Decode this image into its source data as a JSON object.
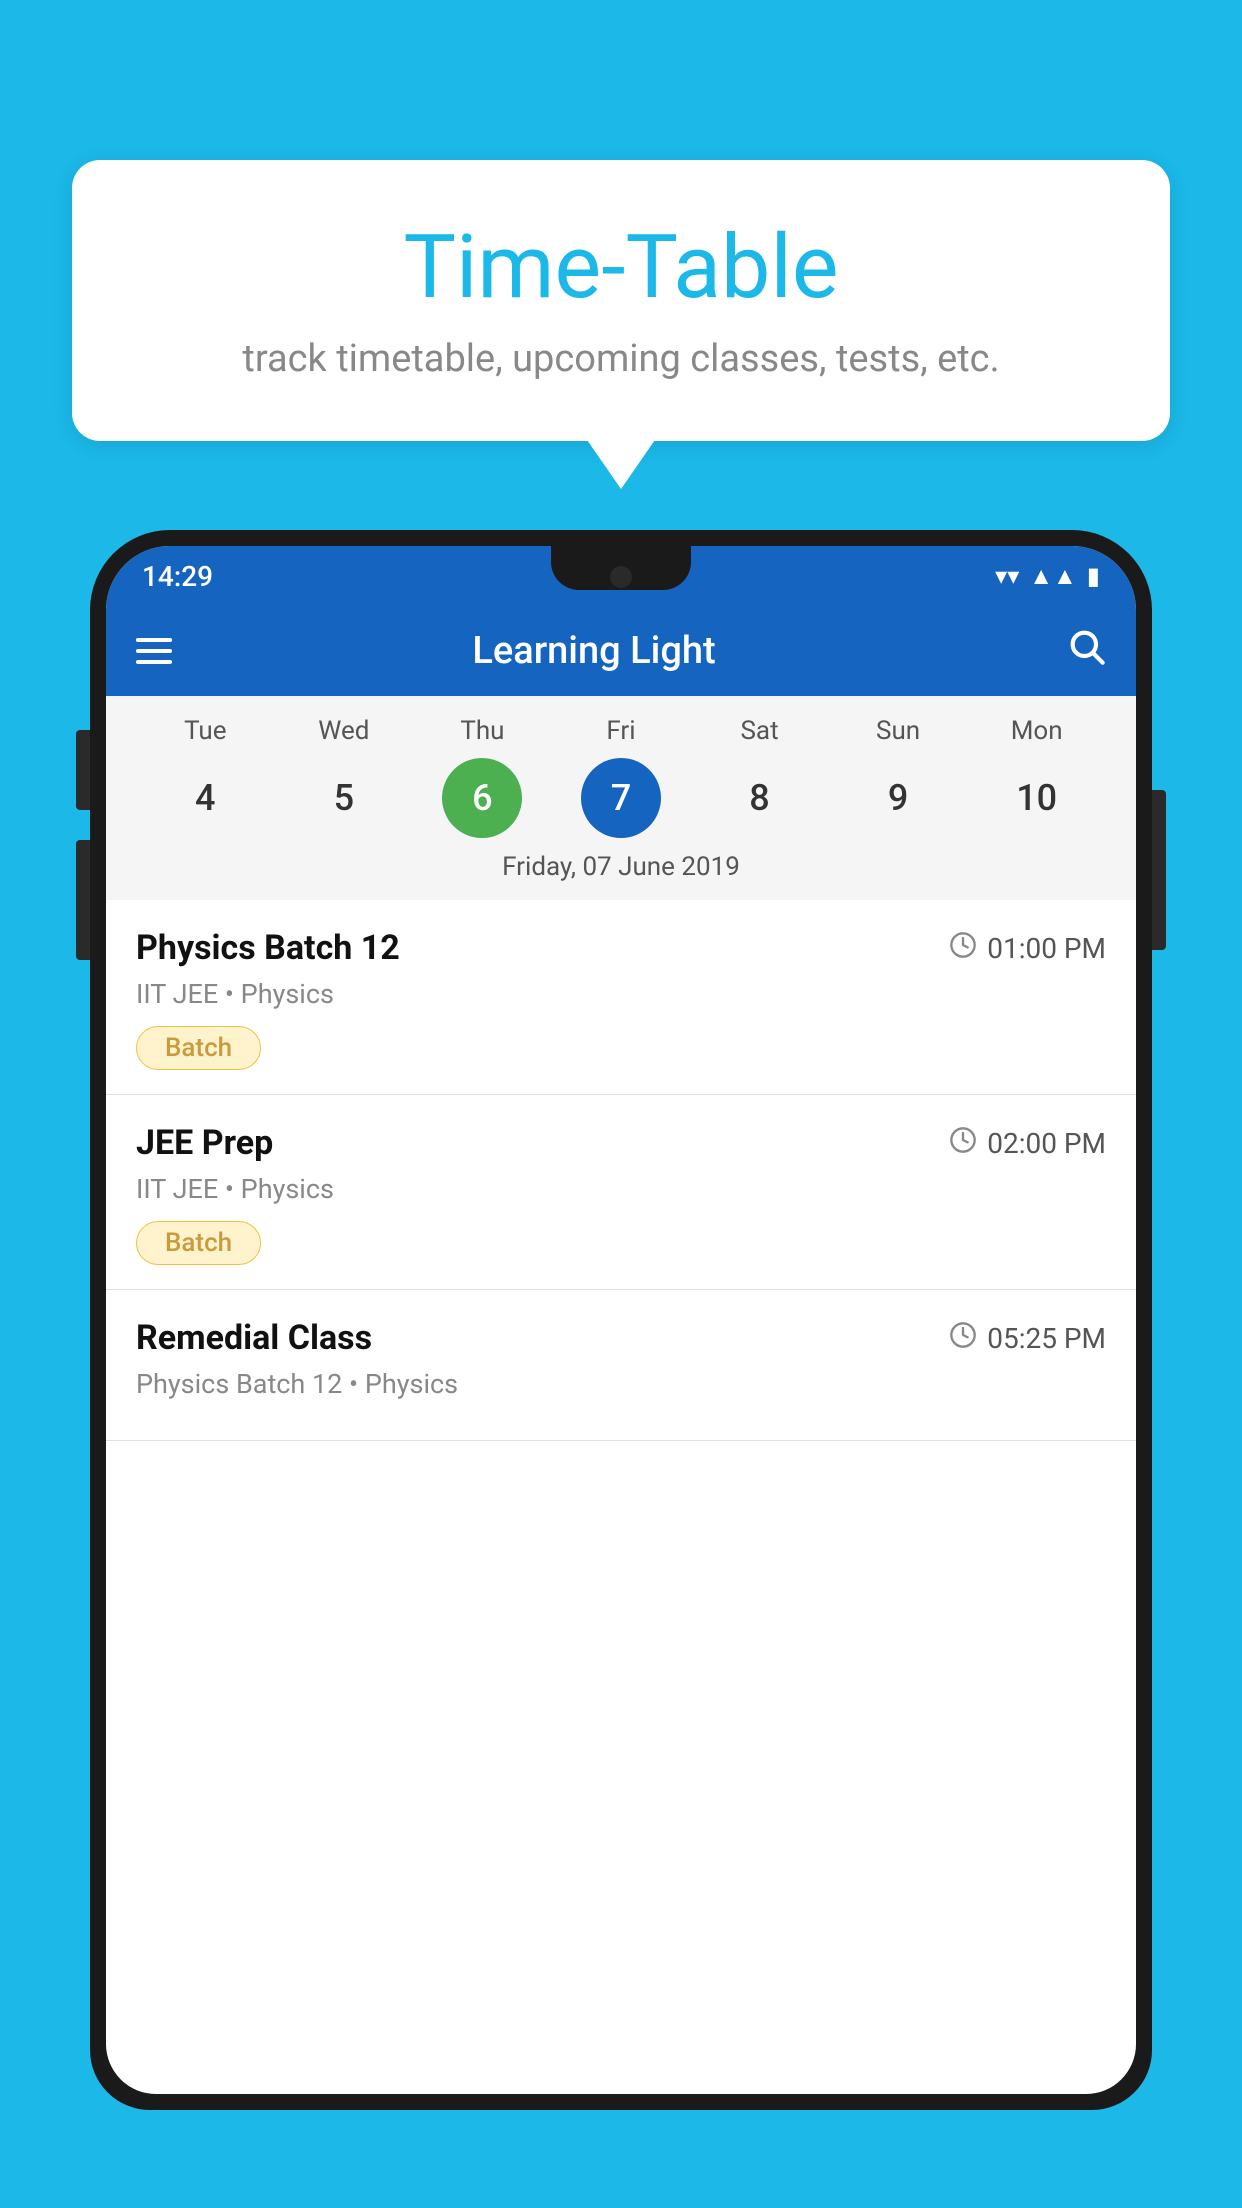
{
  "background_color": "#1BB8E8",
  "speech_bubble": {
    "title": "Time-Table",
    "subtitle": "track timetable, upcoming classes, tests, etc."
  },
  "phone": {
    "status_bar": {
      "time": "14:29",
      "icons": [
        "wifi",
        "signal",
        "battery"
      ]
    },
    "app_bar": {
      "title": "Learning Light",
      "hamburger_label": "menu",
      "search_label": "search"
    },
    "calendar": {
      "days": [
        {
          "label": "Tue",
          "number": "4"
        },
        {
          "label": "Wed",
          "number": "5"
        },
        {
          "label": "Thu",
          "number": "6",
          "state": "today"
        },
        {
          "label": "Fri",
          "number": "7",
          "state": "selected"
        },
        {
          "label": "Sat",
          "number": "8"
        },
        {
          "label": "Sun",
          "number": "9"
        },
        {
          "label": "Mon",
          "number": "10"
        }
      ],
      "selected_date": "Friday, 07 June 2019"
    },
    "schedule": [
      {
        "name": "Physics Batch 12",
        "time": "01:00 PM",
        "detail": "IIT JEE • Physics",
        "badge": "Batch"
      },
      {
        "name": "JEE Prep",
        "time": "02:00 PM",
        "detail": "IIT JEE • Physics",
        "badge": "Batch"
      },
      {
        "name": "Remedial Class",
        "time": "05:25 PM",
        "detail": "Physics Batch 12 • Physics",
        "badge": ""
      }
    ]
  }
}
